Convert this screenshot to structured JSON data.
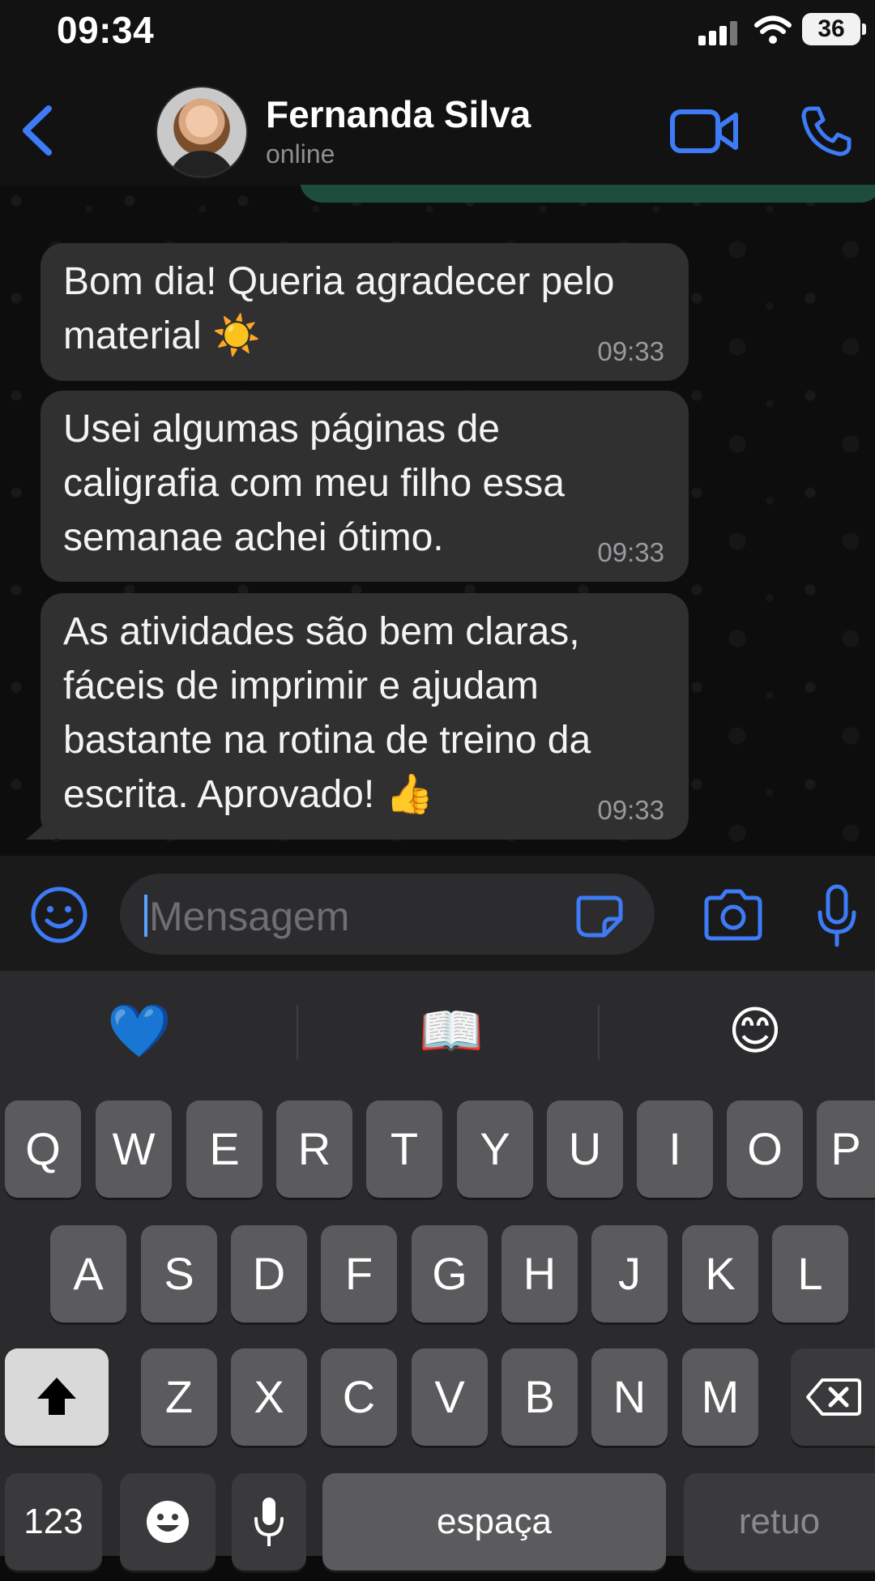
{
  "status_bar": {
    "time": "09:34",
    "battery": "36"
  },
  "header": {
    "contact_name": "Fernanda Silva",
    "contact_status": "online"
  },
  "messages": [
    {
      "text": "Bom dia! Queria agradecer pelo material ☀️",
      "time": "09:33"
    },
    {
      "text": "Usei algumas páginas de caligrafia com meu filho essa semanae achei ótimo.",
      "time": "09:33"
    },
    {
      "text": "As atividades são bem claras, fáceis de imprimir e ajudam bastante na rotina de treino da escrita. Aprovado! 👍",
      "time": "09:33"
    }
  ],
  "input": {
    "placeholder": "Mensagem"
  },
  "suggestions": [
    "💙",
    "📖",
    "😊"
  ],
  "keyboard": {
    "row1": [
      "Q",
      "W",
      "E",
      "R",
      "T",
      "Y",
      "U",
      "I",
      "O",
      "P"
    ],
    "row2": [
      "A",
      "S",
      "D",
      "F",
      "G",
      "H",
      "J",
      "K",
      "L"
    ],
    "row3": [
      "Z",
      "X",
      "C",
      "V",
      "B",
      "N",
      "M"
    ],
    "numbers_key": "123",
    "space_key": "espaça",
    "return_key": "retuo"
  },
  "icons": {
    "back": "chevron-left-icon",
    "video": "video-camera-icon",
    "call": "phone-icon",
    "emoji": "smiley-icon",
    "sticker": "sticker-icon",
    "camera": "camera-icon",
    "mic": "microphone-icon",
    "shift": "shift-arrow-icon",
    "delete": "backspace-icon"
  },
  "colors": {
    "accent": "#3d7bf7",
    "bubble": "#303031",
    "outgoing_bubble": "#1f4d3c"
  }
}
